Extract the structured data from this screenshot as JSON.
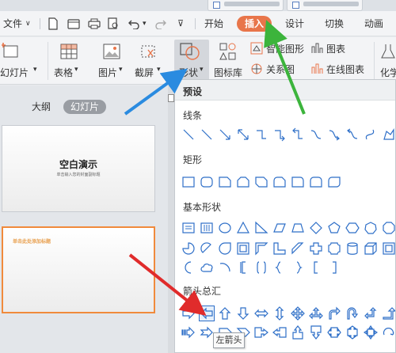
{
  "menu": {
    "file_label": "文件",
    "tabs": [
      {
        "label": "开始"
      },
      {
        "label": "插入"
      },
      {
        "label": "设计"
      },
      {
        "label": "切换"
      },
      {
        "label": "动画"
      }
    ]
  },
  "ribbon": {
    "new_slide": "幻灯片",
    "table": "表格",
    "picture": "图片",
    "screenshot": "截屏",
    "shape": "形状",
    "icon_lib": "图标库",
    "smartart": "智能图形",
    "relation": "关系图",
    "chart": "图表",
    "online_chart": "在线图表",
    "chem": "化学"
  },
  "left_pane": {
    "view_outline": "大纲",
    "view_slides": "幻灯片",
    "slide1_title": "空白演示",
    "slide1_subtitle": "单击输入您的封面副标题",
    "slide2_title": "单击此处添加标题"
  },
  "panel": {
    "header": "预设",
    "sections": {
      "lines": "线条",
      "rect": "矩形",
      "basic": "基本形状",
      "arrows": "箭头总汇"
    },
    "tooltip": "左箭头"
  },
  "colors": {
    "active_tab": "#e8754a",
    "shape_stroke": "#2e6fc8",
    "highlight_border": "#f08a3c",
    "annot_blue": "#2a8be0",
    "annot_green": "#3cb43c",
    "annot_red": "#e02b2b"
  }
}
